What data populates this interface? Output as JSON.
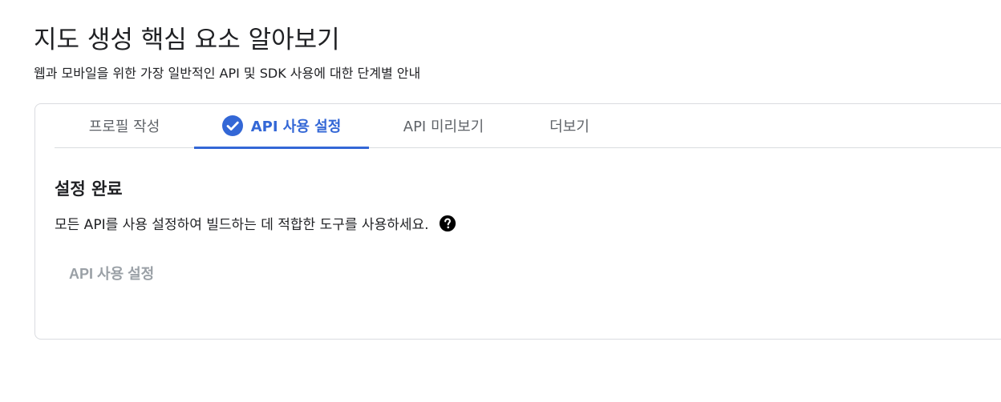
{
  "header": {
    "title": "지도 생성 핵심 요소 알아보기",
    "subtitle": "웹과 모바일을 위한 가장 일반적인 API 및 SDK 사용에 대한 단계별 안내"
  },
  "tabs": [
    {
      "label": "프로필 작성",
      "active": false
    },
    {
      "label": "API 사용 설정",
      "active": true,
      "icon": "check-circle-icon"
    },
    {
      "label": "API 미리보기",
      "active": false
    },
    {
      "label": "더보기",
      "active": false
    }
  ],
  "content": {
    "heading": "설정 완료",
    "description": "모든 API를 사용 설정하여 빌드하는 데 적합한 도구를 사용하세요.",
    "help_icon": "help-circle-icon",
    "button_label": "API 사용 설정"
  },
  "colors": {
    "accent": "#3367d6",
    "text": "#202124",
    "muted": "#5f6368",
    "disabled": "#9aa0a6",
    "border": "#dadce0"
  }
}
